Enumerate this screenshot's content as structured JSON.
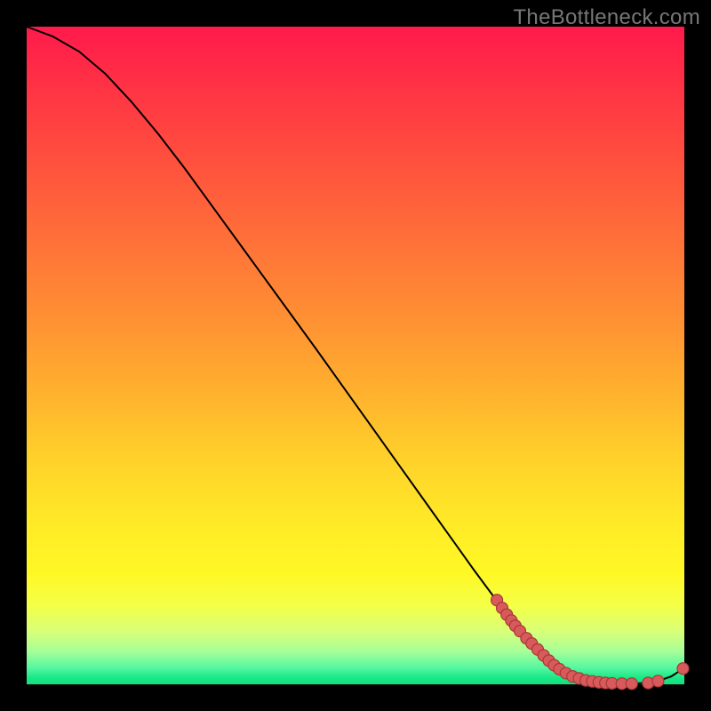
{
  "watermark": "TheBottleneck.com",
  "colors": {
    "point_fill": "#d85a5a",
    "point_stroke": "#a83838",
    "curve": "#000000"
  },
  "chart_data": {
    "type": "line",
    "title": "",
    "xlabel": "",
    "ylabel": "",
    "xlim": [
      0,
      100
    ],
    "ylim": [
      0,
      100
    ],
    "grid": false,
    "legend": false,
    "series": [
      {
        "name": "curve",
        "x": [
          0,
          4,
          8,
          12,
          16,
          20,
          24,
          28,
          32,
          36,
          40,
          44,
          48,
          52,
          56,
          60,
          64,
          68,
          72,
          76,
          80,
          82,
          84,
          86,
          88,
          90,
          92,
          94,
          96,
          98,
          100
        ],
        "y": [
          100,
          98.5,
          96.2,
          92.8,
          88.5,
          83.7,
          78.5,
          73.0,
          67.5,
          62.0,
          56.5,
          51.0,
          45.4,
          39.8,
          34.2,
          28.6,
          23.0,
          17.4,
          12.0,
          7.0,
          3.0,
          1.8,
          1.0,
          0.5,
          0.2,
          0.1,
          0.1,
          0.2,
          0.5,
          1.2,
          2.5
        ]
      }
    ],
    "points": [
      {
        "x": 71.5,
        "y": 12.8
      },
      {
        "x": 72.3,
        "y": 11.6
      },
      {
        "x": 73.0,
        "y": 10.6
      },
      {
        "x": 73.7,
        "y": 9.7
      },
      {
        "x": 74.3,
        "y": 8.9
      },
      {
        "x": 75.0,
        "y": 8.1
      },
      {
        "x": 76.0,
        "y": 7.0
      },
      {
        "x": 76.8,
        "y": 6.2
      },
      {
        "x": 77.7,
        "y": 5.3
      },
      {
        "x": 78.6,
        "y": 4.4
      },
      {
        "x": 79.4,
        "y": 3.6
      },
      {
        "x": 80.2,
        "y": 2.9
      },
      {
        "x": 81.0,
        "y": 2.3
      },
      {
        "x": 82.0,
        "y": 1.7
      },
      {
        "x": 83.0,
        "y": 1.2
      },
      {
        "x": 84.0,
        "y": 0.9
      },
      {
        "x": 85.0,
        "y": 0.6
      },
      {
        "x": 86.0,
        "y": 0.45
      },
      {
        "x": 87.0,
        "y": 0.3
      },
      {
        "x": 88.0,
        "y": 0.2
      },
      {
        "x": 89.0,
        "y": 0.15
      },
      {
        "x": 90.5,
        "y": 0.1
      },
      {
        "x": 92.0,
        "y": 0.1
      },
      {
        "x": 94.5,
        "y": 0.2
      },
      {
        "x": 96.0,
        "y": 0.5
      },
      {
        "x": 99.8,
        "y": 2.4
      }
    ]
  }
}
